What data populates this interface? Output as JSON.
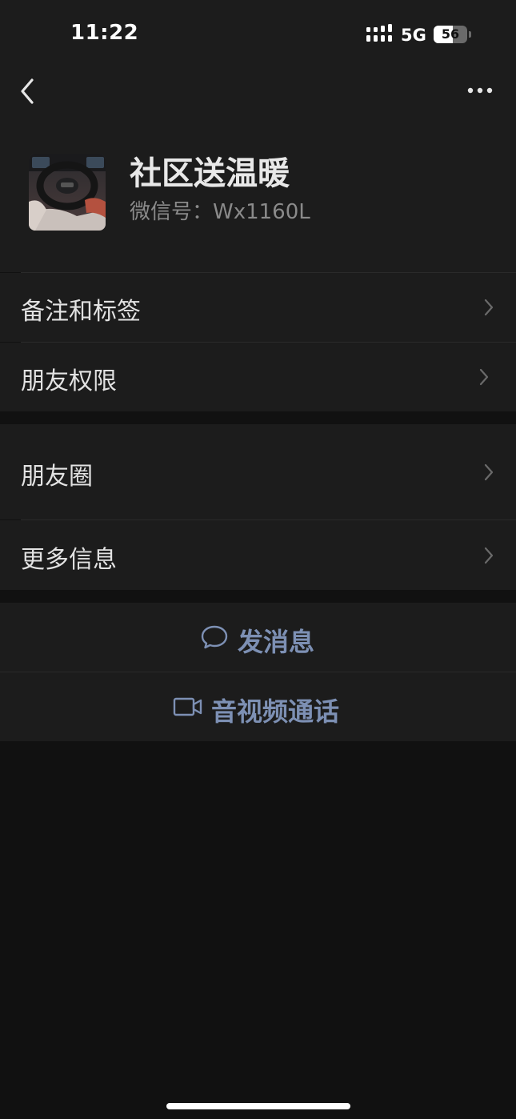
{
  "status_bar": {
    "time": "11:22",
    "network": "5G",
    "battery": "56"
  },
  "nav": {
    "back_icon": "chevron-left-icon",
    "more_icon": "more-dots-icon"
  },
  "profile": {
    "name": "社区送温暖",
    "wechat_id": "微信号：Wx1160L"
  },
  "menu": {
    "remark_tags": "备注和标签",
    "friend_permissions": "朋友权限",
    "moments": "朋友圈",
    "more_info": "更多信息"
  },
  "actions": {
    "send_message": "发消息",
    "video_call": "音视频通话"
  },
  "colors": {
    "background": "#111111",
    "surface": "#1c1c1c",
    "accent_link": "#7d90b4",
    "text_primary": "#e2e2e2",
    "text_secondary": "#8a8a8a"
  }
}
